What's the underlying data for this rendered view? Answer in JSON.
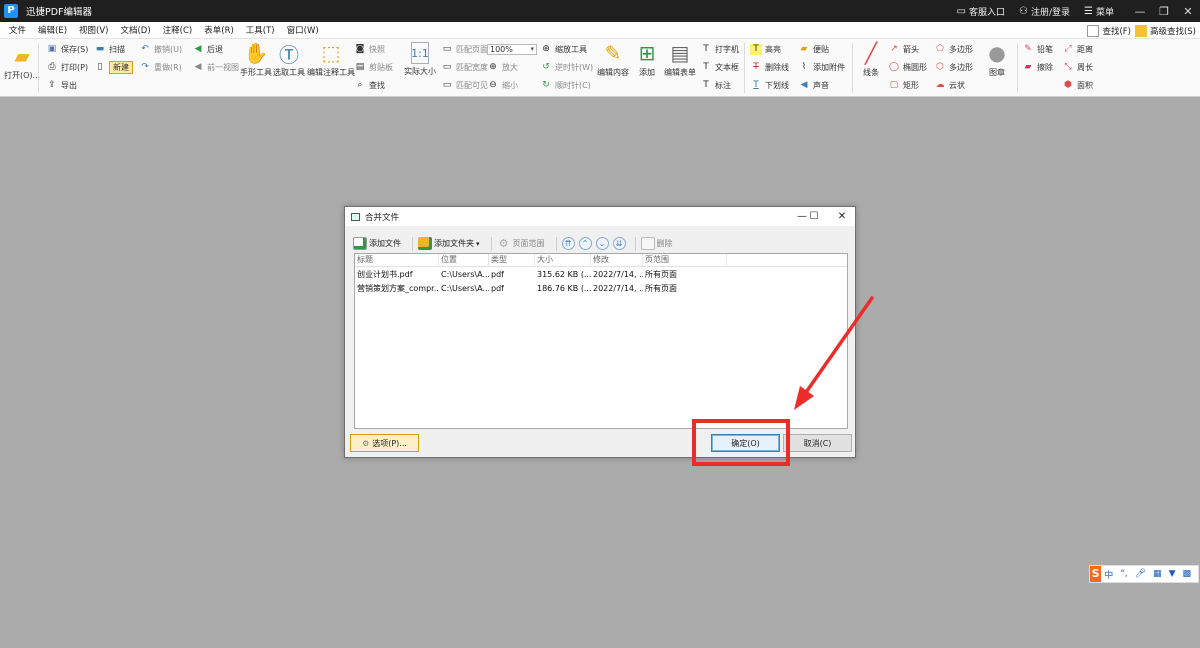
{
  "app": {
    "title": "迅捷PDF编辑器",
    "logo_letter": "P"
  },
  "titlebar_links": {
    "service": "客服入口",
    "login": "注册/登录",
    "menu": "菜单"
  },
  "menubar": {
    "items": [
      "文件",
      "编辑(E)",
      "视图(V)",
      "文档(D)",
      "注释(C)",
      "表单(R)",
      "工具(T)",
      "窗口(W)"
    ],
    "find": "查找(F)",
    "advanced_find": "高级查找(S)"
  },
  "ribbon": {
    "open": "打开(O)...",
    "save": "保存(S)",
    "print": "打印(P)",
    "export": "导出",
    "scan": "扫描",
    "new": "新建",
    "undo": "撤销(U)",
    "redo": "重做(R)",
    "back": "后退",
    "prev_view": "前一视图",
    "hand_tool": "手形工具",
    "select_tool": "选取工具",
    "annot_select": "编辑注释工具",
    "snapshot": "快照",
    "clipboard": "剪贴板",
    "find": "查找",
    "actual_size": "实际大小",
    "fit_page": "匹配页面",
    "fit_width": "匹配宽度",
    "fit_visible": "匹配可见",
    "zoom_value": "100%",
    "zoom_in": "放大",
    "zoom_out": "缩小",
    "zoom_tool": "缩放工具",
    "rotate_ccw": "逆时针(W)",
    "rotate_cw": "顺时针(C)",
    "edit_content": "编辑内容",
    "add": "添加",
    "edit_form": "编辑表单",
    "typewriter": "打字机",
    "textbox": "文本框",
    "callout": "标注",
    "highlight": "高亮",
    "strikeout": "删除线",
    "underline": "下划线",
    "note": "便贴",
    "attach": "添加附件",
    "sound": "声音",
    "line": "线条",
    "arrow": "箭头",
    "ellipse": "椭圆形",
    "rect": "矩形",
    "polygon": "多边形",
    "polyline": "多边形",
    "cloud": "云状",
    "stamp": "图章",
    "pencil": "铅笔",
    "eraser": "擦除",
    "distance": "距离",
    "perimeter": "周长",
    "area": "面积"
  },
  "dialog": {
    "title": "合并文件",
    "toolbar": {
      "add_file": "添加文件",
      "add_folder": "添加文件夹",
      "page_range": "页面范围",
      "delete": "删除"
    },
    "columns": [
      "标题",
      "位置",
      "类型",
      "大小",
      "修改",
      "页范围"
    ],
    "rows": [
      {
        "title": "创业计划书.pdf",
        "location": "C:\\Users\\A...",
        "type": "pdf",
        "size": "315.62 KB (...",
        "modified": "2022/7/14, ...",
        "pages": "所有页面"
      },
      {
        "title": "营销策划方案_compr...",
        "location": "C:\\Users\\A...",
        "type": "pdf",
        "size": "186.76 KB (...",
        "modified": "2022/7/14, ...",
        "pages": "所有页面"
      }
    ],
    "options": "选项(P)...",
    "ok": "确定(O)",
    "cancel": "取消(C)"
  },
  "ime": {
    "logo": "S",
    "mode": "中"
  },
  "colors": {
    "annotation_red": "#ee2b2b",
    "titlebar": "#1f1f1f",
    "workspace": "#ababab"
  }
}
